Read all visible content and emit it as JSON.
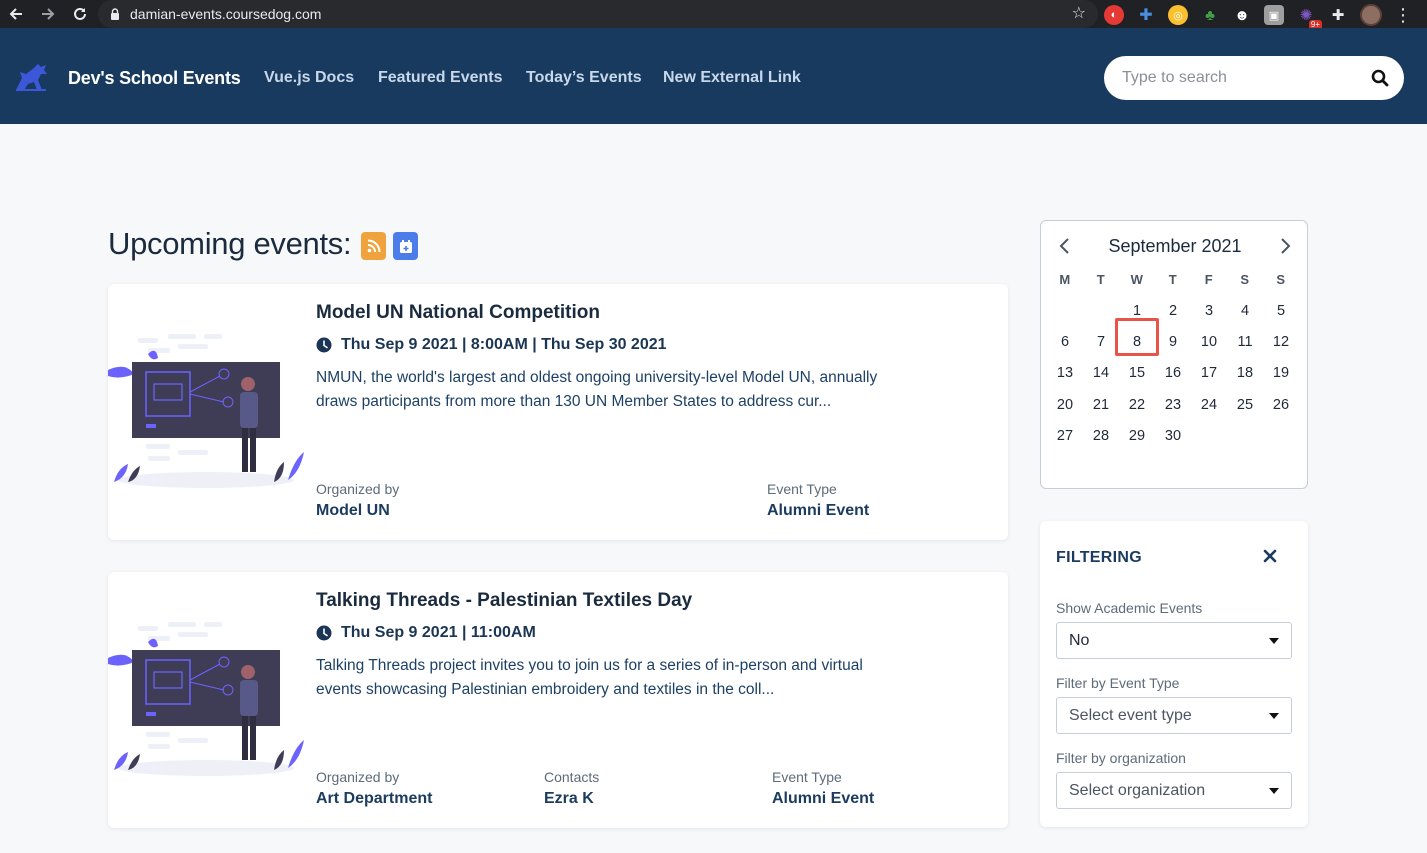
{
  "browser": {
    "url": "damian-events.coursedog.com",
    "ext_badge": "9+"
  },
  "header": {
    "brand": "Dev's School Events",
    "nav": [
      "Vue.js Docs",
      "Featured Events",
      "Today’s Events",
      "New External Link"
    ],
    "search_placeholder": "Type to search"
  },
  "main": {
    "heading": "Upcoming events:",
    "events": [
      {
        "title": "Model UN National Competition",
        "when": "Thu Sep 9 2021 | 8:00AM | Thu Sep 30 2021",
        "desc_line1": "NMUN, the world's largest and oldest ongoing university-level Model UN, annually",
        "desc_line2": "draws participants from more than 130 UN Member States to address cur...",
        "org_label": "Organized by",
        "org": "Model UN",
        "type_label": "Event Type",
        "type": "Alumni Event"
      },
      {
        "title": "Talking Threads - Palestinian Textiles Day",
        "when": "Thu Sep 9 2021 | 11:00AM",
        "desc_line1": "Talking Threads project invites you to join us for a series of in-person and virtual",
        "desc_line2": "events showcasing Palestinian embroidery and textiles in the coll...",
        "org_label": "Organized by",
        "org": "Art Department",
        "contacts_label": "Contacts",
        "contacts": "Ezra K",
        "type_label": "Event Type",
        "type": "Alumni Event"
      }
    ]
  },
  "calendar": {
    "title": "September 2021",
    "weekdays": [
      "M",
      "T",
      "W",
      "T",
      "F",
      "S",
      "S"
    ],
    "first_weekday_index": 2,
    "days_in_month": 30,
    "selected_day": "8"
  },
  "filters": {
    "title": "FILTERING",
    "academic_label": "Show Academic Events",
    "academic_value": "No",
    "type_label": "Filter by Event Type",
    "type_placeholder": "Select event type",
    "org_label": "Filter by organization",
    "org_placeholder": "Select organization"
  },
  "colors": {
    "header_bg": "#173a5e",
    "rss": "#f0a33c",
    "calendar_btn": "#4a7dea",
    "selected_outline": "#e8534a"
  }
}
